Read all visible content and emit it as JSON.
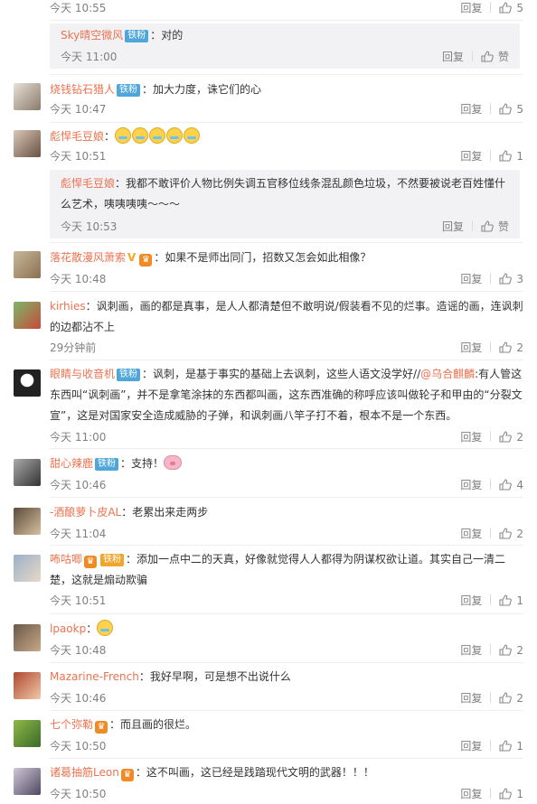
{
  "labels": {
    "reply": "回复",
    "like_zero": "赞"
  },
  "badge": {
    "tiefen": "铁粉"
  },
  "comments": [
    {
      "time": "今天 10:55",
      "likes": "5"
    },
    {
      "user": "Sky晴空微风",
      "sep": "：",
      "text": "对的",
      "time": "今天 11:00"
    },
    {
      "user": "烧钱钻石猎人",
      "sep": "：",
      "text": "加大力度，诛它们的心",
      "time": "今天 10:47",
      "likes": "5"
    },
    {
      "user": "彪悍毛豆娘",
      "sep": "：",
      "time": "今天 10:51",
      "likes": "1"
    },
    {
      "user": "彪悍毛豆娘",
      "sep": "：",
      "text": "我都不敢评价人物比例失调五官移位线条混乱颜色垃圾，不然要被说老百姓懂什么艺术，咦咦咦咦～～～",
      "time": "今天 10:53"
    },
    {
      "user": "落花散漫风萧索",
      "sep": "：",
      "text": "如果不是师出同门，招数又怎会如此相像？",
      "time": "今天 10:48",
      "likes": "3"
    },
    {
      "user": "kirhies",
      "sep": "：",
      "text": "讽刺画，画的都是真事，是人人都清楚但不敢明说/假装看不见的烂事。造谣的画，连讽刺的边都沾不上",
      "time": "29分钟前",
      "likes": "2"
    },
    {
      "user": "眼睛与收音机",
      "sep": "：",
      "text1": "讽刺，是基于事实的基础上去讽刺，这些人语文没学好//",
      "mention": "@乌合麒麟",
      "text2": ":有人管这东西叫“讽刺画”，并不是拿笔涂抹的东西都叫画，这东西准确的称呼应该叫做轮子和甲由的“分裂文宣”，这是对国家安全造成威胁的子弹，和讽刺画八竿子打不着，根本不是一个东西。",
      "time": "今天 11:00",
      "likes": "2"
    },
    {
      "user": "甜心辣鹿",
      "sep": "：",
      "text": "支持！",
      "time": "今天 10:46",
      "likes": "4"
    },
    {
      "user": "-酒酿萝卜皮AL",
      "sep": "：",
      "text": "老累出来走两步",
      "time": "今天 11:04",
      "likes": "2"
    },
    {
      "user": "咘咕唧",
      "sep": "：",
      "text": "添加一点中二的天真，好像就觉得人人都得为阴谋权欲让道。其实自己一清二楚，这就是煽动欺骗",
      "time": "今天 10:51",
      "likes": "1"
    },
    {
      "user": "lpaokp",
      "sep": "：",
      "time": "今天 10:48",
      "likes": "2"
    },
    {
      "user": "Mazarine-French",
      "sep": "：",
      "text": "我好早啊，可是想不出说什么",
      "time": "今天 10:46",
      "likes": "2"
    },
    {
      "user": "七个弥勒",
      "sep": "：",
      "text": "而且画的很烂。",
      "time": "今天 10:50",
      "likes": "1"
    },
    {
      "user": "诸葛抽筋Leon",
      "sep": "：",
      "text": "这不叫画，这已经是践踏现代文明的武器！！！",
      "time": "今天 10:50",
      "likes": "1"
    }
  ],
  "icons": {
    "like": "thumbs-up-icon"
  },
  "colors": {
    "username": "#eb7350",
    "badge": "#4ea6d9",
    "meta": "#808080",
    "sub_bg": "#f2f2f5"
  }
}
